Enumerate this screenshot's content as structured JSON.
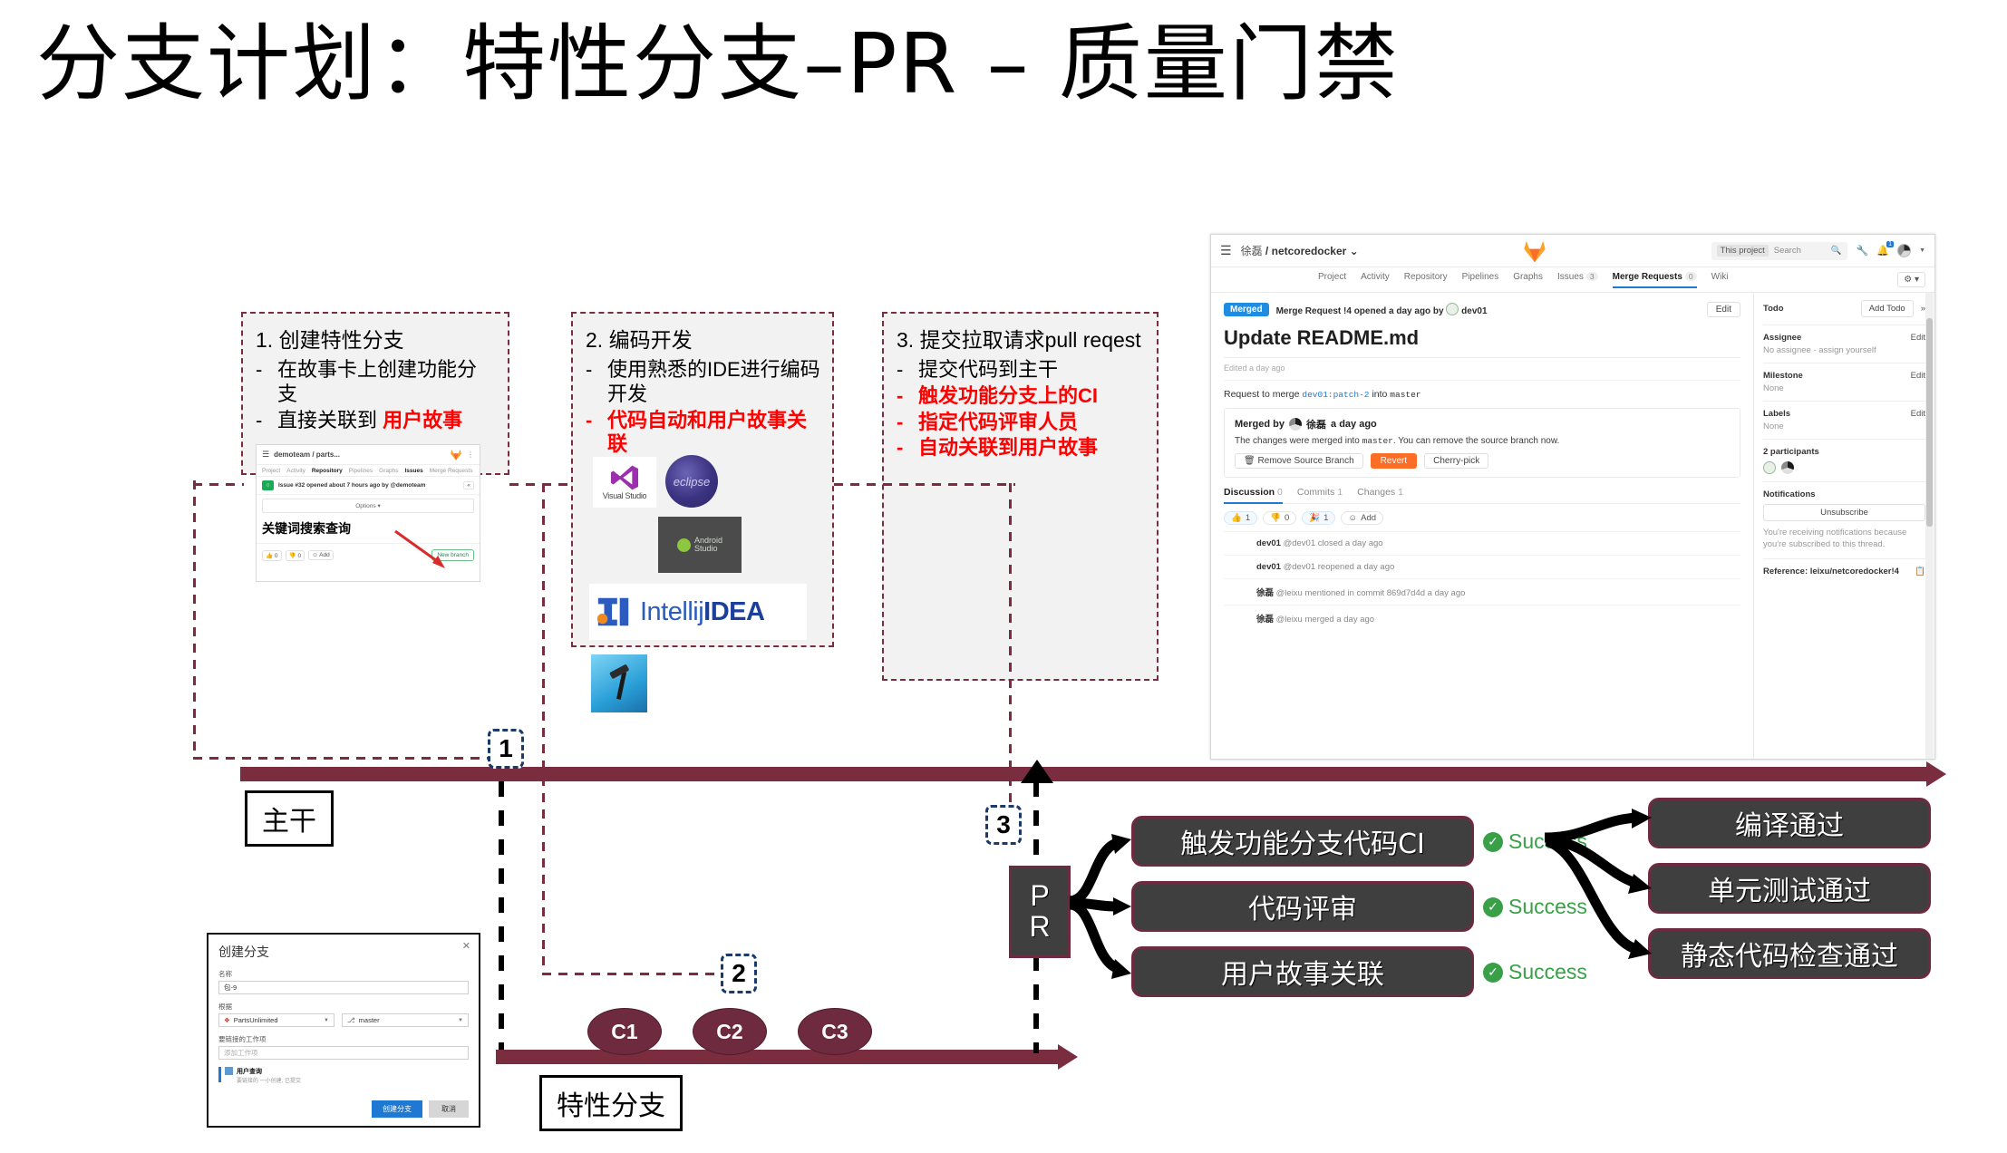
{
  "title": "分支计划：特性分支–PR – 质量门禁",
  "steps": [
    {
      "number": "1.",
      "heading": "创建特性分支",
      "bullets": [
        {
          "text": "在故事卡上创建功能分",
          "text2": "支",
          "red": false
        },
        {
          "text": "直接关联到 ",
          "highlight": "用户故事",
          "red": false
        }
      ]
    },
    {
      "number": "2.",
      "heading": "编码开发",
      "bullets": [
        {
          "text": "使用熟悉的IDE进行编码",
          "text2": "开发",
          "red": false
        },
        {
          "text": "代码自动和用户故事关",
          "text2": "联",
          "red": true
        }
      ]
    },
    {
      "number": "3.",
      "heading": "提交拉取请求pull reqest",
      "bullets": [
        {
          "text": "提交代码到主干",
          "red": false
        },
        {
          "text": "触发功能分支上的CI",
          "red": true
        },
        {
          "text": "指定代码评审人员",
          "red": true
        },
        {
          "text": "自动关联到用户故事",
          "red": true
        }
      ]
    }
  ],
  "mini_shot": {
    "project": "demoteam / parts...",
    "nav": [
      "Project",
      "Activity",
      "Repository",
      "Pipelines",
      "Graphs",
      "Issues",
      "Merge Requests"
    ],
    "active_nav": "Issues",
    "bold_nav": "Repository",
    "issue_meta": "Issue #32 opened about 7 hours ago by @demoteam",
    "options_label": "Options",
    "issue_title": "关键词搜索查询",
    "thumbs_up": "0",
    "thumbs_down": "0",
    "add_label": "Add",
    "new_branch_label": "New branch",
    "collapse_label": "«"
  },
  "ide_logos": [
    {
      "name": "Visual Studio",
      "label": "Visual Studio"
    },
    {
      "name": "Eclipse",
      "label": "eclipse"
    },
    {
      "name": "Xcode",
      "label": ""
    },
    {
      "name": "Android Studio",
      "label": "Android Studio"
    },
    {
      "name": "IntelliJ IDEA",
      "label_light": "Intellij",
      "label_bold": "IDEA"
    }
  ],
  "gitlab": {
    "breadcrumb_namespace": "徐磊",
    "breadcrumb_sep": "/",
    "breadcrumb_project": "netcoredocker",
    "breadcrumb_caret": "⌄",
    "search_scope": "This project",
    "search_placeholder": "Search",
    "bell_count": "1",
    "nav": [
      {
        "label": "Project",
        "count": "",
        "active": false
      },
      {
        "label": "Activity",
        "count": "",
        "active": false
      },
      {
        "label": "Repository",
        "count": "",
        "active": false
      },
      {
        "label": "Pipelines",
        "count": "",
        "active": false
      },
      {
        "label": "Graphs",
        "count": "",
        "active": false
      },
      {
        "label": "Issues",
        "count": "3",
        "active": false
      },
      {
        "label": "Merge Requests",
        "count": "0",
        "active": true
      },
      {
        "label": "Wiki",
        "count": "",
        "active": false
      }
    ],
    "status_badge": "Merged",
    "mr_meta_pre": "Merge Request !4 opened a day ago by",
    "mr_author": "dev01",
    "edit_label": "Edit",
    "mr_title": "Update README.md",
    "edited_note": "Edited a day ago",
    "request_pre": "Request to merge",
    "source_branch": "dev01:patch-2",
    "request_mid": "into",
    "target_branch": "master",
    "merged_by_pre": "Merged by",
    "merged_by_user": "徐磊",
    "merged_by_post": "a day ago",
    "merge_desc_pre": "The changes were merged into",
    "merge_desc_branch": "master",
    "merge_desc_post": ". You can remove the source branch now.",
    "btn_remove_source": "Remove Source Branch",
    "btn_revert": "Revert",
    "btn_cherry_pick": "Cherry-pick",
    "tabs": [
      {
        "label": "Discussion",
        "count": "0",
        "active": true
      },
      {
        "label": "Commits",
        "count": "1",
        "active": false
      },
      {
        "label": "Changes",
        "count": "1",
        "active": false
      }
    ],
    "reactions": [
      {
        "icon": "👍",
        "count": "1"
      },
      {
        "icon": "👎",
        "count": "0"
      },
      {
        "icon": "🎉",
        "count": "1"
      }
    ],
    "add_reaction_label": "Add",
    "feed": [
      {
        "user": "dev01",
        "text": "@dev01 closed a day ago"
      },
      {
        "user": "dev01",
        "text": "@dev01 reopened a day ago"
      },
      {
        "user": "徐磊",
        "text": "@leixu mentioned in commit 869d7d4d a day ago",
        "commit": "869d7d4d"
      },
      {
        "user": "徐磊",
        "text": "@leixu merged a day ago"
      }
    ],
    "sidebar": {
      "todo_label": "Todo",
      "add_todo_label": "Add Todo",
      "collapse_icon": "»",
      "assignee_label": "Assignee",
      "assignee_value": "No assignee - assign yourself",
      "milestone_label": "Milestone",
      "milestone_value": "None",
      "labels_label": "Labels",
      "labels_value": "None",
      "participants_label": "2 participants",
      "notifications_label": "Notifications",
      "unsubscribe_label": "Unsubscribe",
      "notifications_note": "You're receiving notifications because you're subscribed to this thread.",
      "reference_label": "Reference: leixu/netcoredocker!4",
      "edit_label": "Edit"
    }
  },
  "timeline": {
    "master_label": "主干",
    "feature_label": "特性分支",
    "commits": [
      "C1",
      "C2",
      "C3"
    ],
    "markers": [
      "1",
      "2",
      "3"
    ]
  },
  "pipeline": {
    "pr_line1": "P",
    "pr_line2": "R",
    "stages": [
      {
        "label": "触发功能分支代码CI",
        "status": "Success"
      },
      {
        "label": "代码评审",
        "status": "Success"
      },
      {
        "label": "用户故事关联",
        "status": "Success"
      }
    ],
    "results": [
      "编译通过",
      "单元测试通过",
      "静态代码检查通过"
    ],
    "check_glyph": "✓"
  },
  "create_branch_dialog": {
    "title": "创建分支",
    "close": "✕",
    "name_label": "名称",
    "name_value": "包-9",
    "based_label": "根据",
    "repo_value": "PartsUnlimited",
    "branch_value": "master",
    "workitem_label": "要链接的工作项",
    "workitem_placeholder": "添加工作项",
    "workitem_title": "用户查询",
    "workitem_sub": "要链接的 一小创建, 已提交",
    "btn_create": "创建分支",
    "btn_cancel": "取消"
  },
  "colors": {
    "maroon": "#7b2d40",
    "dark_box": "#3f3f3f",
    "success_green": "#3aa047",
    "red": "#ff0000",
    "marker_navy": "#1b3a6b"
  }
}
